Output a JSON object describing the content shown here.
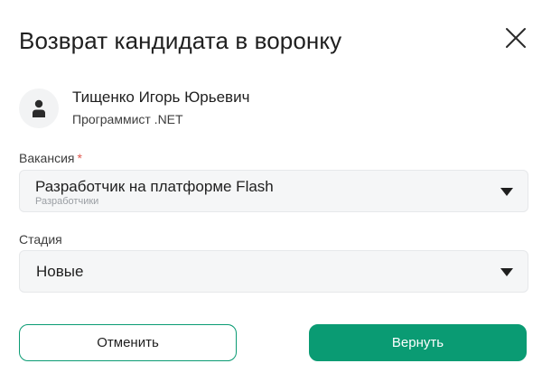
{
  "dialog": {
    "title": "Возврат кандидата в воронку"
  },
  "candidate": {
    "name": "Тищенко Игорь Юрьевич",
    "role": "Программист .NET"
  },
  "vacancy": {
    "label": "Вакансия",
    "required_mark": "*",
    "selected": "Разработчик на платформе Flash",
    "selected_sub": "Разработчики"
  },
  "stage": {
    "label": "Стадия",
    "selected": "Новые"
  },
  "actions": {
    "cancel_label": "Отменить",
    "return_label": "Вернуть"
  },
  "colors": {
    "accent": "#0a9b73",
    "required": "#e0584e"
  },
  "icons": {
    "close": "close-icon",
    "avatar": "person-icon",
    "dropdown": "caret-down-icon"
  }
}
